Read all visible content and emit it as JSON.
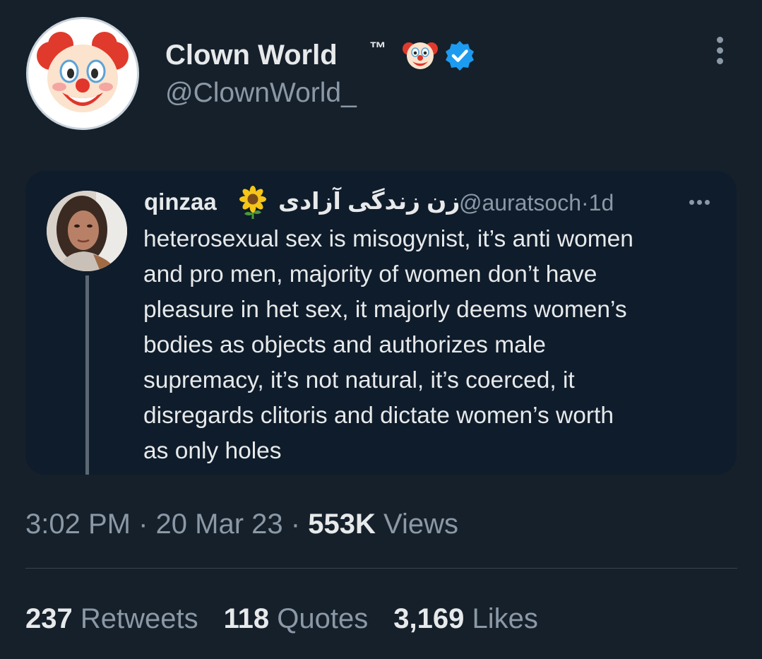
{
  "tweet": {
    "author": {
      "display_name": "Clown World",
      "trademark": "™",
      "handle": "@ClownWorld_",
      "avatar_icon": "clown-face-icon",
      "badge_icon": "verified-badge-icon",
      "badge_color": "#1d9bf0"
    },
    "quoted": {
      "name": "qinzaa",
      "emoji_icon": "sunflower-icon",
      "name_persian": "زن زندگی آزادی",
      "handle": "@auratsoch",
      "separator": "·",
      "age": "1d",
      "text": "heterosexual sex is misogynist, it’s anti women\nand pro men, majority of women don’t have\npleasure in het sex, it majorly deems women’s\nbodies as objects and authorizes male\nsupremacy, it’s not natural, it’s coerced, it\ndisregards clitoris and dictate women’s worth\nas only holes"
    },
    "meta": {
      "time": "3:02 PM",
      "separator": "·",
      "date": "20 Mar 23",
      "views_count": "553K",
      "views_label": "Views"
    },
    "stats": {
      "retweets_count": "237",
      "retweets_label": "Retweets",
      "quotes_count": "118",
      "quotes_label": "Quotes",
      "likes_count": "3,169",
      "likes_label": "Likes"
    }
  },
  "colors": {
    "background": "#15202b",
    "quote_background": "#0f1c2b",
    "primary_text": "#e7e9ea",
    "secondary_text": "#8b98a5",
    "divider": "#38444d",
    "verified": "#1d9bf0"
  }
}
